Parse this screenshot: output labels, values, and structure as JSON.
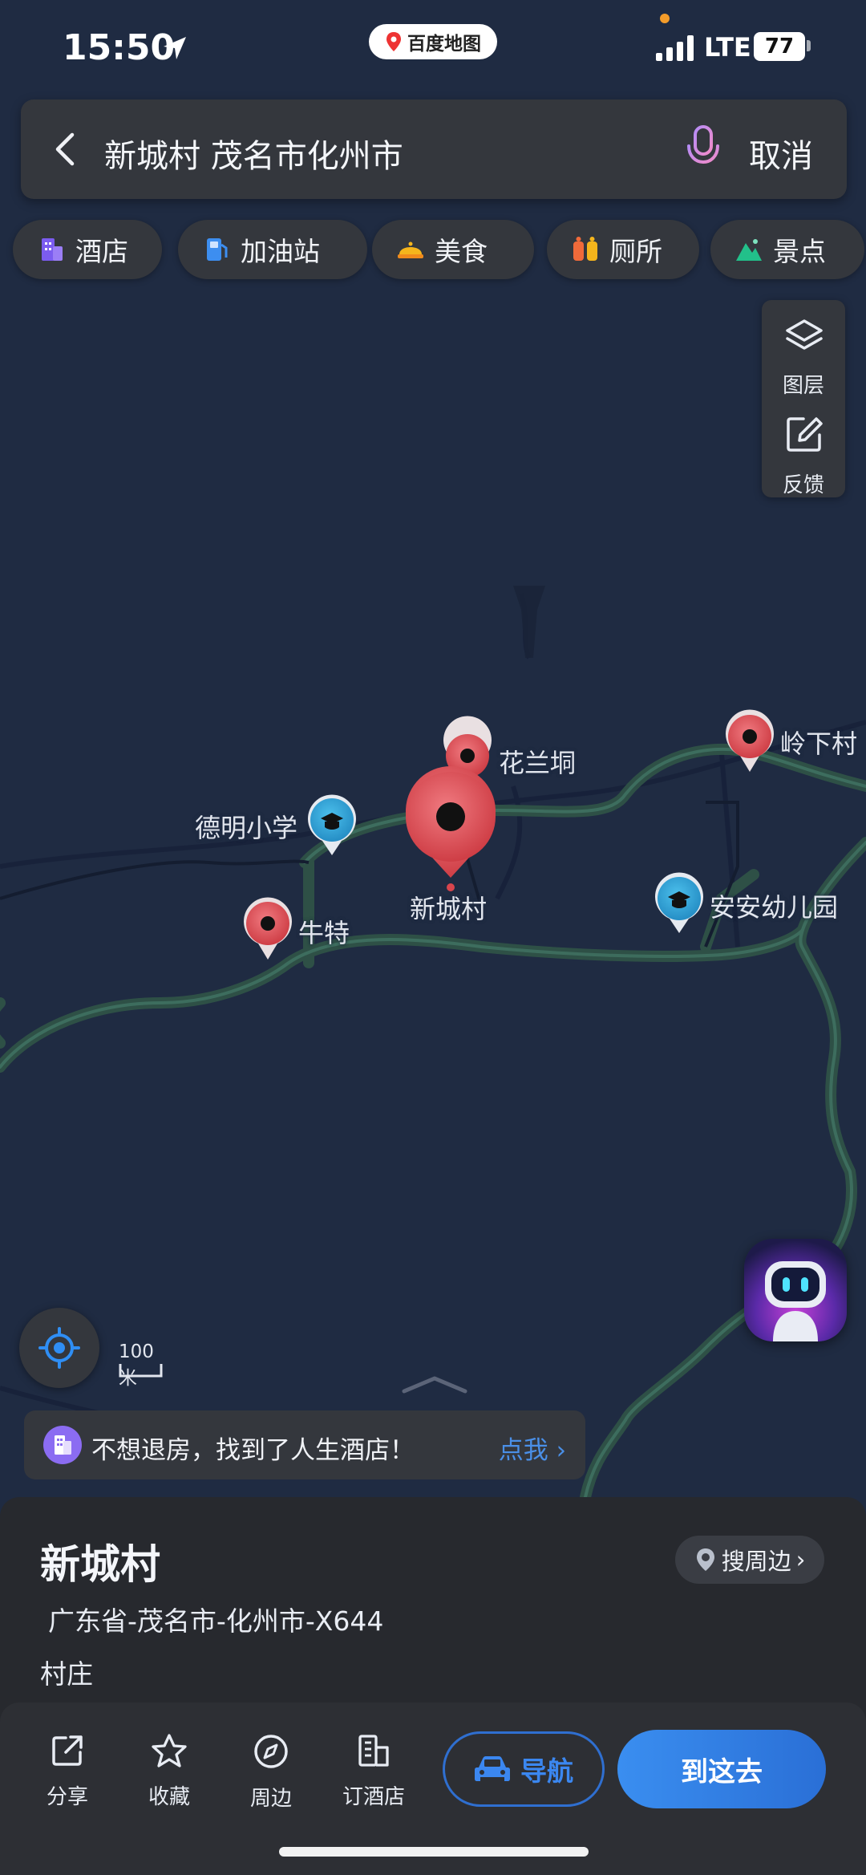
{
  "status_bar": {
    "time": "15:50",
    "app": "百度地图",
    "network": "LTE",
    "battery": "77"
  },
  "search": {
    "query": "新城村 茂名市化州市",
    "cancel_label": "取消"
  },
  "categories": [
    {
      "label": "酒店",
      "icon": "hotel-icon",
      "color": "#7b5cf0"
    },
    {
      "label": "加油站",
      "icon": "gas-station-icon",
      "color": "#3d8ef0"
    },
    {
      "label": "美食",
      "icon": "food-icon",
      "color": "#f5b51c"
    },
    {
      "label": "厕所",
      "icon": "toilet-icon",
      "color": "#f06a3a"
    },
    {
      "label": "景点",
      "icon": "scenic-icon",
      "color": "#22c08a"
    }
  ],
  "map_tools": {
    "layers_label": "图层",
    "feedback_label": "反馈"
  },
  "map_labels": {
    "hualandong": "花兰垌",
    "lingxiacun": "岭下村",
    "demingxiaoxue": "德明小学",
    "xinchengcun": "新城村",
    "anan_kindergarten": "安安幼儿园",
    "niute": "牛特"
  },
  "scale": {
    "label": "100米"
  },
  "promo": {
    "text": "不想退房，找到了人生酒店！",
    "link": "点我"
  },
  "place": {
    "name": "新城村",
    "address": "广东省-茂名市-化州市-X644",
    "type": "村庄",
    "nearby_label": "搜周边"
  },
  "actions": {
    "share": "分享",
    "favorite": "收藏",
    "around": "周边",
    "book_hotel": "订酒店",
    "navigate": "导航",
    "go_here": "到这去"
  },
  "colors": {
    "accent": "#2f7ae5",
    "pin_red": "#d9454d",
    "pin_blue": "#2a9fd6",
    "map_bg": "#1f2b42"
  }
}
